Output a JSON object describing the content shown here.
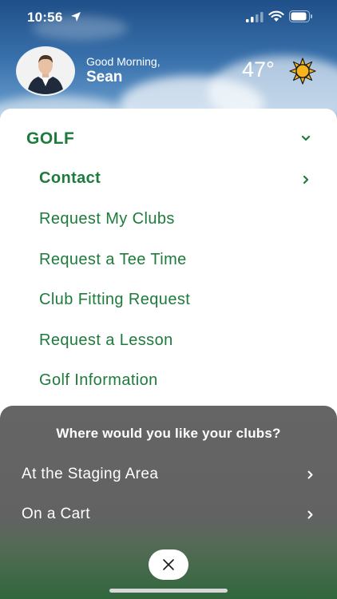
{
  "status_bar": {
    "time": "10:56"
  },
  "header": {
    "greeting": "Good Morning,",
    "user_name": "Sean",
    "temperature": "47°",
    "weather_icon": "sun-icon"
  },
  "menu": {
    "section_title": "GOLF",
    "items": [
      {
        "label": "Contact",
        "active": true
      },
      {
        "label": "Request My Clubs"
      },
      {
        "label": "Request a Tee Time"
      },
      {
        "label": "Club Fitting Request"
      },
      {
        "label": "Request a Lesson"
      },
      {
        "label": "Golf Information"
      }
    ]
  },
  "sheet": {
    "title": "Where would you like your clubs?",
    "options": [
      {
        "label": "At the Staging Area"
      },
      {
        "label": "On a Cart"
      }
    ],
    "close_icon": "close-icon"
  },
  "colors": {
    "brand_green": "#1e7b3c",
    "sheet_gray": "#606060"
  }
}
